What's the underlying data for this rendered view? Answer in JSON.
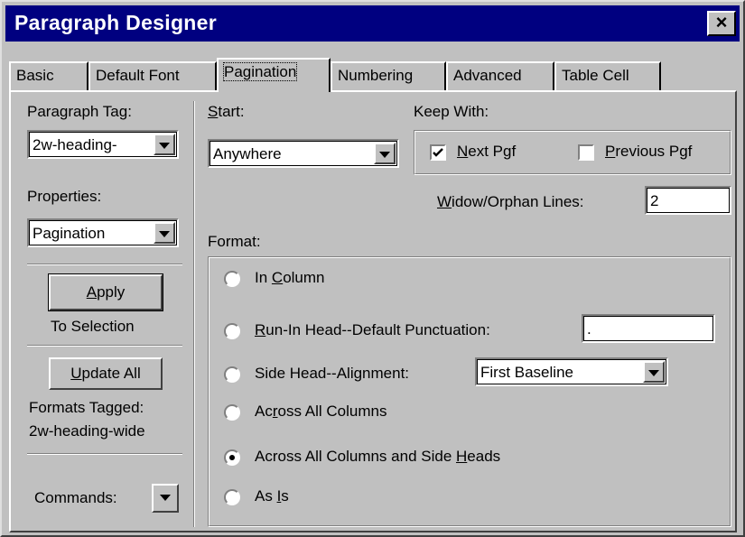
{
  "window": {
    "title": "Paragraph Designer",
    "close": "×"
  },
  "tabs": [
    "Basic",
    "Default Font",
    "Pagination",
    "Numbering",
    "Advanced",
    "Table Cell"
  ],
  "left": {
    "tag_label": "Paragraph Tag:",
    "tag_value": "2w-heading-",
    "properties_label": "Properties:",
    "properties_value": "Pagination",
    "apply_hotkey": "A",
    "apply_rest": "pply",
    "to_selection": "To Selection",
    "update_hotkey": "U",
    "update_rest": "pdate All",
    "formats_tagged": "Formats Tagged:",
    "tag_name": "2w-heading-wide",
    "commands": "Commands:"
  },
  "start": {
    "label_hotkey": "S",
    "label_rest": "tart:",
    "value": "Anywhere"
  },
  "keep_with": {
    "label": "Keep With:",
    "next_hotkey": "N",
    "next_rest": "ext Pgf",
    "next_checked": true,
    "prev_hotkey": "P",
    "prev_rest": "revious Pgf",
    "prev_checked": false
  },
  "widow": {
    "label_hotkey": "W",
    "label_rest": "idow/Orphan Lines:",
    "value": "2"
  },
  "format": {
    "label": "Format:",
    "in_column_pre": "In ",
    "in_column_hotkey": "C",
    "in_column_post": "olumn",
    "runin_hotkey": "R",
    "runin_rest": "un-In Head--Default Punctuation:",
    "runin_value": ".",
    "sidehead": "Side Head--Alignment:",
    "sidehead_value": "First Baseline",
    "across_pre": "Ac",
    "across_hotkey": "r",
    "across_post": "oss All Columns",
    "across_side_pre": "Across All Columns and Side ",
    "across_side_hotkey": "H",
    "across_side_post": "eads",
    "asis_pre": "As ",
    "asis_hotkey": "I",
    "asis_post": "s",
    "selected": "across_side_heads"
  }
}
